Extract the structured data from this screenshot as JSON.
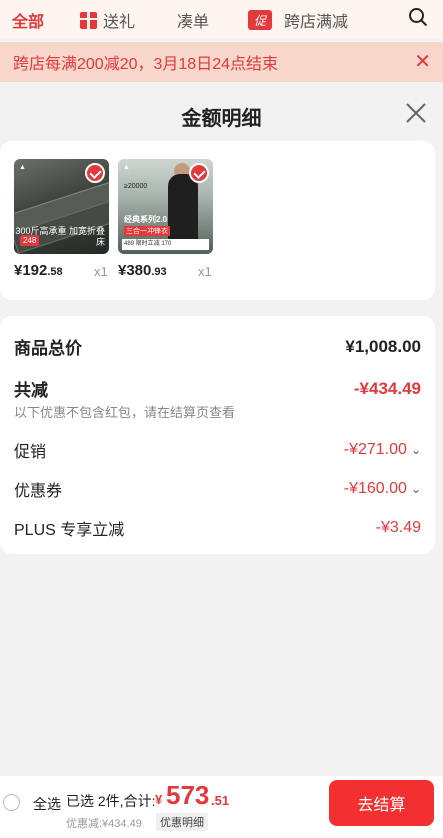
{
  "top_nav": {
    "tabs": [
      "全部",
      "送礼",
      "凑单",
      "跨店满减"
    ],
    "promo_icon_text": "促"
  },
  "notice": {
    "text": "跨店每满200减20，3月18日24点结束"
  },
  "sheet": {
    "title": "金额明细",
    "products": [
      {
        "image_caption": "300斤高承重 加宽折叠床",
        "image_price_badge": "248",
        "price_int": "¥192",
        "price_dec": ".58",
        "qty": "x1"
      },
      {
        "image_caption_1": "≥20000",
        "image_caption_2": "经典系列2.0",
        "image_caption_3": "三合一冲锋衣",
        "image_caption_4": "489 限时立减 170",
        "price_int": "¥380",
        "price_dec": ".93",
        "qty": "x1"
      }
    ],
    "summary": {
      "total_label": "商品总价",
      "total_value": "¥1,008.00",
      "reduce_label": "共减",
      "reduce_value": "-¥434.49",
      "reduce_note": "以下优惠不包含红包，请在结算页查看",
      "promo_label": "促销",
      "promo_value": "-¥271.00",
      "coupon_label": "优惠券",
      "coupon_value": "-¥160.00",
      "plus_label": "PLUS 专享立减",
      "plus_value": "-¥3.49"
    }
  },
  "bottom_bar": {
    "select_all": "全选",
    "selected_text": "已选 2件,合计:",
    "total_symbol": "¥",
    "total_int": "573",
    "total_dec": ".51",
    "discount_text": "优惠减:¥434.49",
    "detail_link": "优惠明细",
    "checkout": "去结算"
  },
  "colors": {
    "accent": "#e4393c",
    "checkout_bg": "#f23030"
  }
}
